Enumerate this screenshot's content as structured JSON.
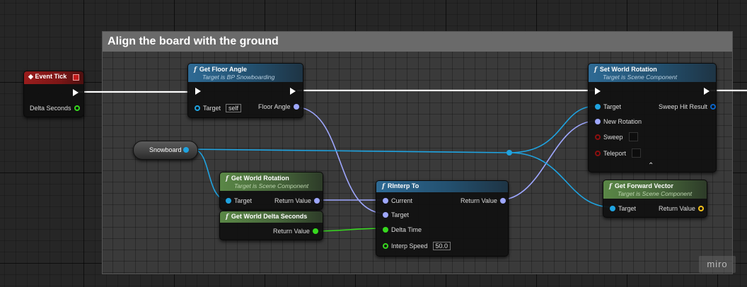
{
  "comment": {
    "title": "Align the board with the ground"
  },
  "nodes": {
    "event_tick": {
      "title": "Event Tick",
      "pin_delta": "Delta Seconds"
    },
    "get_floor_angle": {
      "title": "Get Floor Angle",
      "subtitle": "Target is BP Snowboarding",
      "pin_target": "Target",
      "target_value": "self",
      "pin_floor_angle": "Floor Angle"
    },
    "snowboard": {
      "label": "Snowboard"
    },
    "get_world_rotation": {
      "title": "Get World Rotation",
      "subtitle": "Target is Scene Component",
      "pin_target": "Target",
      "pin_return": "Return Value"
    },
    "get_world_delta": {
      "title": "Get World Delta Seconds",
      "pin_return": "Return Value"
    },
    "rinterp": {
      "title": "RInterp To",
      "pin_current": "Current",
      "pin_return": "Return Value",
      "pin_target": "Target",
      "pin_delta": "Delta Time",
      "pin_speed": "Interp Speed",
      "speed_value": "50.0"
    },
    "set_world_rotation": {
      "title": "Set World Rotation",
      "subtitle": "Target is Scene Component",
      "pin_target": "Target",
      "pin_sweep_hit": "Sweep Hit Result",
      "pin_new_rotation": "New Rotation",
      "pin_sweep": "Sweep",
      "pin_teleport": "Teleport",
      "expand_glyph": "⌃"
    },
    "get_forward_vector": {
      "title": "Get Forward Vector",
      "subtitle": "Target is Scene Component",
      "pin_target": "Target",
      "pin_return": "Return Value"
    }
  },
  "watermark": "miro",
  "colors": {
    "exec": "#ffffff",
    "object": "#1fa3e0",
    "rotator": "#9ea7ff",
    "float": "#37d81f",
    "bool": "#8b0f0f",
    "vector": "#f3c01b",
    "struct": "#0a64c8"
  },
  "icons": {
    "function": "function-icon",
    "event": "event-diamond-icon"
  }
}
